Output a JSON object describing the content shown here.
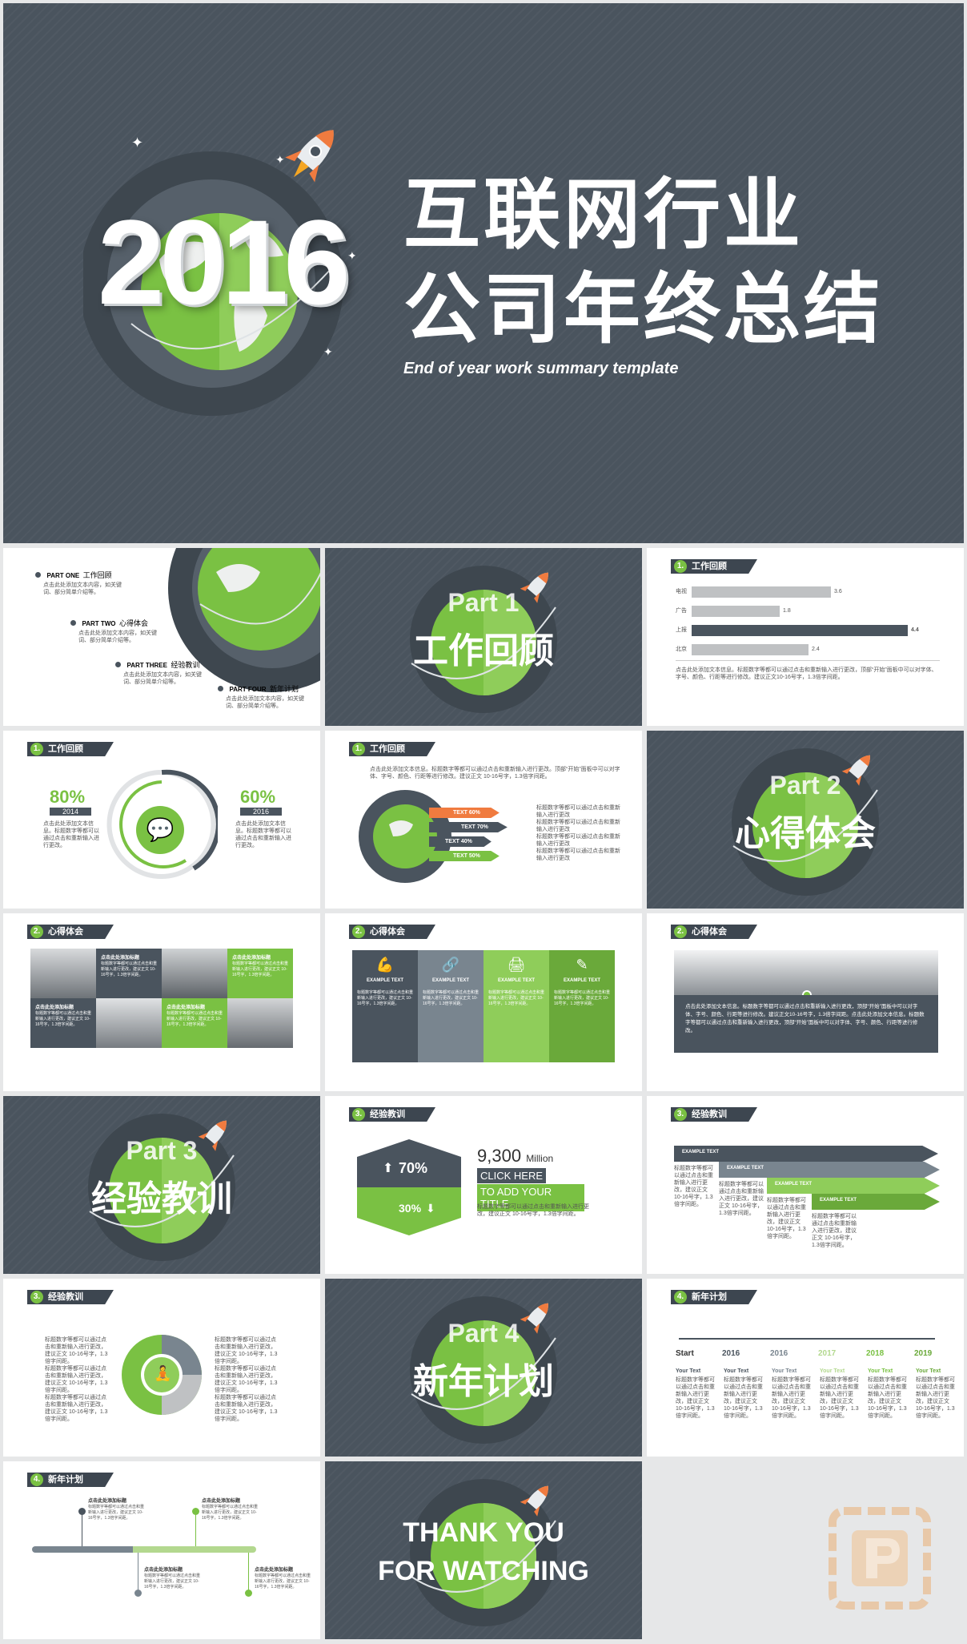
{
  "hero": {
    "year": "2016",
    "title_line1": "互联网行业",
    "title_line2": "公司年终总结",
    "subtitle": "End of year work summary template"
  },
  "toc": {
    "items": [
      {
        "part": "PART ONE",
        "label": "工作回顾",
        "desc": "点击此处添加文本内容，如关键词、部分简单介绍等。"
      },
      {
        "part": "PART TWO",
        "label": "心得体会",
        "desc": "点击此处添加文本内容，如关键词、部分简单介绍等。"
      },
      {
        "part": "PART THREE",
        "label": "经验教训",
        "desc": "点击此处添加文本内容，如关键词、部分简单介绍等。"
      },
      {
        "part": "PART FOUR",
        "label": "新年计划",
        "desc": "点击此处添加文本内容，如关键词、部分简单介绍等。"
      }
    ]
  },
  "parts": {
    "p1": {
      "en": "Part 1",
      "cn": "工作回顾"
    },
    "p2": {
      "en": "Part 2",
      "cn": "心得体会"
    },
    "p3": {
      "en": "Part 3",
      "cn": "经验教训"
    },
    "p4": {
      "en": "Part 4",
      "cn": "新年计划"
    },
    "thanks1": "THANK YOU",
    "thanks2": "FOR WATCHING"
  },
  "sections": {
    "s1": {
      "num": "1.",
      "label": "工作回顾"
    },
    "s2": {
      "num": "2.",
      "label": "心得体会"
    },
    "s3": {
      "num": "3.",
      "label": "经验教训"
    },
    "s4": {
      "num": "4.",
      "label": "新年计划"
    }
  },
  "bar_chart": {
    "rows": [
      {
        "label": "电视",
        "value": "3.6"
      },
      {
        "label": "广告",
        "value": "1.8"
      },
      {
        "label": "上报",
        "value": "4.4"
      },
      {
        "label": "北京",
        "value": "2.4"
      }
    ],
    "desc": "点击此处添加文本信息。标题数字等都可以通过点击和重新输入进行更改，顶部“开始”面板中可以对字体、字号、颜色、行距等进行修改。建议正文10-16号字，1.3倍字间距。"
  },
  "wechat": {
    "left_pct": "80%",
    "left_year": "2014",
    "right_pct": "60%",
    "right_year": "2016",
    "desc": "点击此处添加文本信息。标题数字等都可以通过点击和重新输入进行更改。"
  },
  "globe_info": {
    "intro": "点击此处添加文本信息。标题数字等都可以通过点击和重新输入进行更改。顶部“开始”面板中可以对字体、字号、颜色、行距等进行修改。建议正文 10-16号字，1.3倍字间距。",
    "tags": [
      "TEXT  60%",
      "TEXT  70%",
      "TEXT  40%",
      "TEXT  50%"
    ],
    "item_text": "标题数字等都可以通过点击和重新输入进行更改"
  },
  "grid_photos": {
    "caption_title": "点击此处添加标题",
    "caption_text": "标题数字等都可以通过点击和重新输入进行更改，建议正文 10-16号字，1.3倍字间距。"
  },
  "four_cards": {
    "label": "EXAMPLE TEXT",
    "text": "标题数字等都可以通过点击和重新输入进行更改，建议正文 10-16号字，1.3倍字间距。",
    "icons": [
      "muscle-icon",
      "link-icon",
      "printer-icon",
      "edit-icon"
    ]
  },
  "city_banner": {
    "text": "点击此处添加文本信息。标题数字等都可以通过点击和重新输入进行更改，顶部“开始”面板中可以对字体、字号、颜色、行距等进行修改。建议正文10-16号字，1.3倍字间距。点击此处添加文本信息。标题数字等都可以通过点击和重新输入进行更改，顶部“开始”面板中可以对字体、字号、颜色、行距等进行修改。"
  },
  "stats": {
    "up_pct": "70%",
    "down_pct": "30%",
    "big_number": "9,300",
    "big_unit": "Million",
    "click_here": "CLICK HERE",
    "add_title": "TO ADD YOUR TITLE",
    "desc": "标题数字等都可以通过点击和重新输入进行更改，建议正文 10-16号字，1.3倍字间距。"
  },
  "arrows": {
    "labels": [
      "EXAMPLE TEXT",
      "EXAMPLE TEXT",
      "EXAMPLE TEXT",
      "EXAMPLE TEXT"
    ],
    "text": "标题数字等都可以通过点击和重新输入进行更改，建议正文 10-16号字，1.3倍字间距。"
  },
  "ring": {
    "text": "标题数字等都可以通过点击和重新输入进行更改，建议正文 10-16号字，1.3倍字间距。"
  },
  "timeline": {
    "start": "Start",
    "years": [
      "2016",
      "2016",
      "2017",
      "2018",
      "2019"
    ],
    "item_title": "Your Text",
    "item_text": "标题数字等都可以通过点击和重新输入进行更改，建议正文 10-16号字，1.3倍字间距。"
  },
  "plan": {
    "title": "点击此处添加标题",
    "text": "标题数字等都可以通过点击和重新输入进行更改，建议正文 10-16号字，1.3倍字间距。"
  },
  "colors": {
    "dark": "#4a545e",
    "green": "#7ac143",
    "orange": "#f07b3f",
    "grey": "#bfc1c3"
  }
}
